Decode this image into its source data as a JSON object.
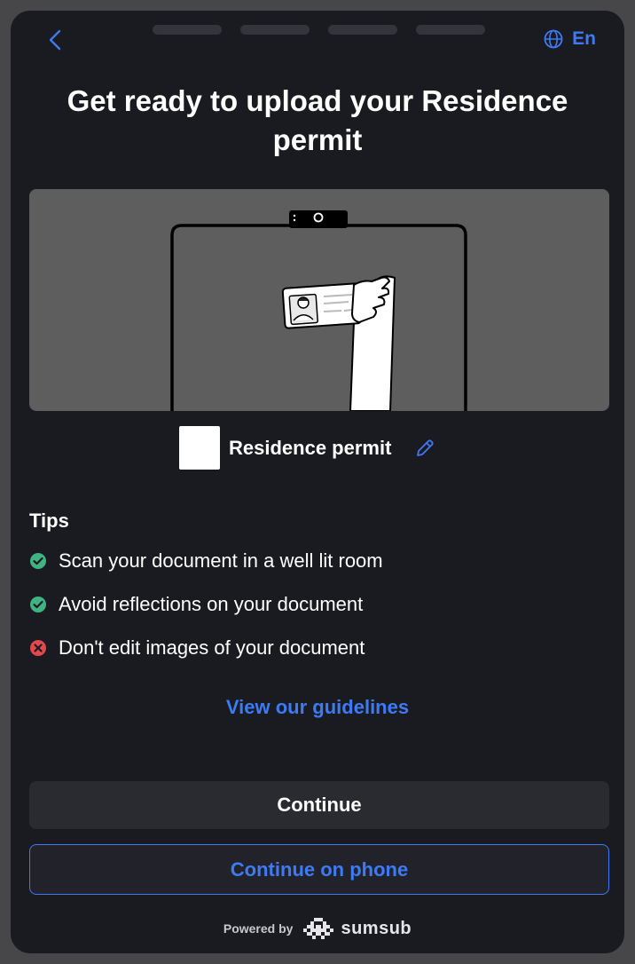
{
  "header": {
    "language_label": "En",
    "progress_steps": 4
  },
  "title": "Get ready to upload your Residence permit",
  "document": {
    "name": "Residence permit"
  },
  "tips": {
    "title": "Tips",
    "items": [
      {
        "text": "Scan your document in a well lit room",
        "status": "ok",
        "icon": "check-circle-icon"
      },
      {
        "text": "Avoid reflections on your document",
        "status": "ok",
        "icon": "check-circle-icon"
      },
      {
        "text": "Don't edit images of your document",
        "status": "bad",
        "icon": "x-circle-icon"
      }
    ]
  },
  "guidelines_link": "View our guidelines",
  "buttons": {
    "continue": "Continue",
    "continue_on_phone": "Continue on phone"
  },
  "footer": {
    "powered_by": "Powered by",
    "brand": "sumsub"
  },
  "colors": {
    "accent": "#3d7af5",
    "ok": "#3fb382",
    "bad": "#e2484d",
    "background": "#1a1b21"
  }
}
